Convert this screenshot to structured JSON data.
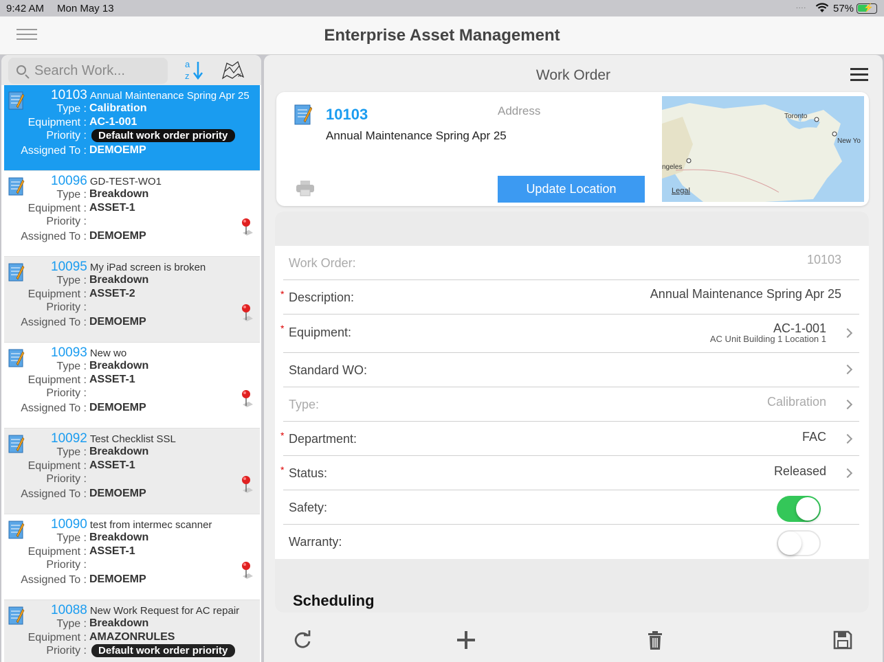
{
  "status_bar": {
    "time": "9:42 AM",
    "date": "Mon May 13",
    "dots": "....",
    "battery_pct": "57%",
    "battery_level": 0.57
  },
  "app": {
    "title": "Enterprise Asset Management"
  },
  "search": {
    "placeholder": "Search Work..."
  },
  "sort_icon": {
    "top": "a",
    "bottom": "z"
  },
  "labels": {
    "type": "Type :",
    "equipment": "Equipment :",
    "priority": "Priority :",
    "assigned": "Assigned To :"
  },
  "work_orders": [
    {
      "number": "10103",
      "desc": "Annual Maintenance Spring Apr 25",
      "type": "Calibration",
      "equipment": "AC-1-001",
      "priority": "Default work order priority",
      "assigned": "DEMOEMP"
    },
    {
      "number": "10096",
      "desc": "GD-TEST-WO1",
      "type": "Breakdown",
      "equipment": "ASSET-1",
      "priority": "",
      "assigned": "DEMOEMP"
    },
    {
      "number": "10095",
      "desc": "My iPad screen is broken",
      "type": "Breakdown",
      "equipment": "ASSET-2",
      "priority": "",
      "assigned": "DEMOEMP"
    },
    {
      "number": "10093",
      "desc": "New wo",
      "type": "Breakdown",
      "equipment": "ASSET-1",
      "priority": "",
      "assigned": "DEMOEMP"
    },
    {
      "number": "10092",
      "desc": "Test Checklist SSL",
      "type": "Breakdown",
      "equipment": "ASSET-1",
      "priority": "",
      "assigned": "DEMOEMP"
    },
    {
      "number": "10090",
      "desc": "test from intermec scanner",
      "type": "Breakdown",
      "equipment": "ASSET-1",
      "priority": "",
      "assigned": "DEMOEMP"
    },
    {
      "number": "10088",
      "desc": "New Work Request for AC repair",
      "type": "Breakdown",
      "equipment": "AMAZONRULES",
      "priority": "Default work order priority",
      "assigned": ""
    }
  ],
  "detail": {
    "title": "Work Order",
    "number": "10103",
    "address_label": "Address",
    "description": "Annual Maintenance Spring Apr 25",
    "update_location": "Update Location",
    "map": {
      "toronto": "Toronto",
      "newyork": "New Yo",
      "la": "ngeles",
      "legal": "Legal"
    }
  },
  "form": {
    "work_order": {
      "label": "Work Order:",
      "value": "10103"
    },
    "description": {
      "label": "Description:",
      "value": "Annual Maintenance Spring Apr 25"
    },
    "equipment": {
      "label": "Equipment:",
      "value": "AC-1-001",
      "sub": "AC Unit Building 1 Location 1"
    },
    "standard_wo": {
      "label": "Standard WO:",
      "value": ""
    },
    "type": {
      "label": "Type:",
      "value": "Calibration"
    },
    "department": {
      "label": "Department:",
      "value": "FAC"
    },
    "status": {
      "label": "Status:",
      "value": "Released"
    },
    "safety": {
      "label": "Safety:",
      "on": true
    },
    "warranty": {
      "label": "Warranty:",
      "on": false
    },
    "required_mark": "*",
    "scheduling": "Scheduling"
  },
  "colors": {
    "accent": "#1a9cf0",
    "button": "#3c9af2",
    "toggle_on": "#34c759",
    "required": "#dd0000"
  }
}
